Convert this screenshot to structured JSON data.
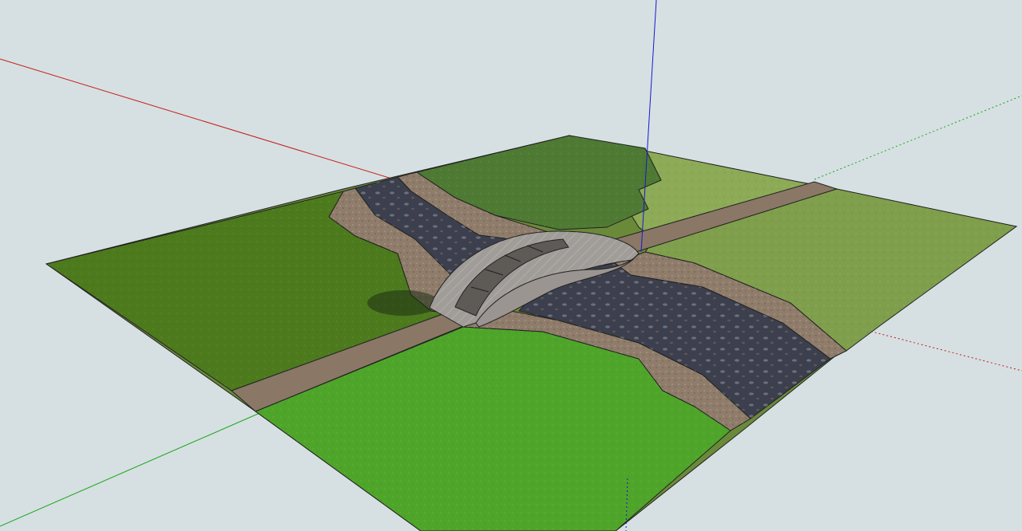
{
  "app": {
    "view": "3d-model-viewport",
    "background_color": "#d6e0e2"
  },
  "axes": {
    "red": "#c81a1a",
    "green": "#1ea51e",
    "blue": "#1a1acc"
  },
  "model": {
    "surfaces": [
      {
        "name": "grass-back-center",
        "color": "#4e7a33"
      },
      {
        "name": "grass-back-right",
        "color": "#8dab57"
      },
      {
        "name": "grass-right",
        "color": "#7f9f4c"
      },
      {
        "name": "grass-left",
        "color": "#4c7a1d"
      },
      {
        "name": "grass-front",
        "color": "#4ea52a"
      },
      {
        "name": "river-water",
        "color": "#3c3f4d"
      },
      {
        "name": "gravel-bank",
        "color": "#8f7c6a"
      },
      {
        "name": "footpath",
        "color": "#8a7766"
      },
      {
        "name": "stone-bridge",
        "color": "#a09c98"
      }
    ]
  }
}
